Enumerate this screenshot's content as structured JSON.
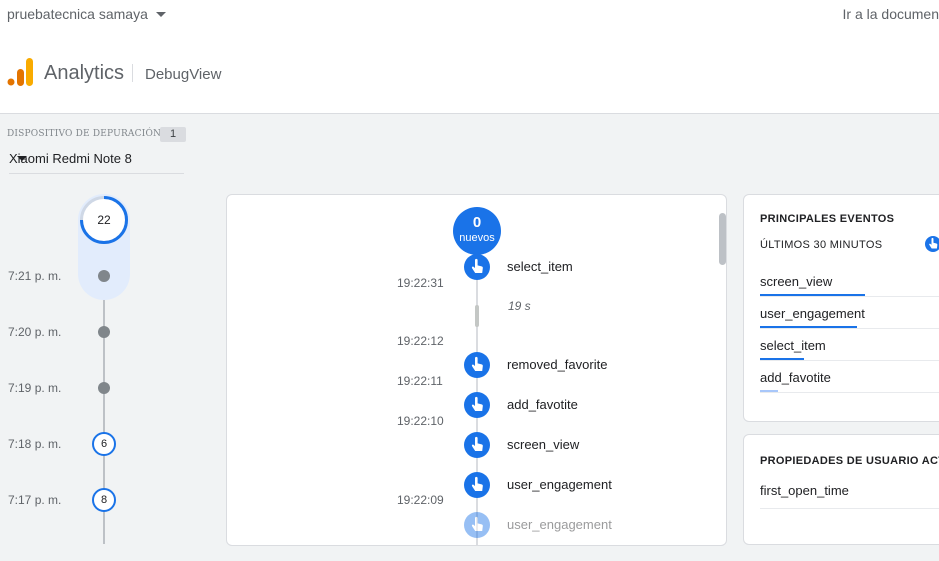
{
  "header": {
    "account": "pruebatecnica samaya",
    "doc_link": "Ir a la documen",
    "brand": "Analytics",
    "product": "DebugView"
  },
  "device": {
    "label": "DISPOSITIVO DE DEPURACIÓN",
    "count": "1",
    "selected": "Xiaomi Redmi Note 8"
  },
  "minutes": {
    "current_count": "22",
    "rows": [
      {
        "time": "7:21 p. m.",
        "count": ""
      },
      {
        "time": "7:20 p. m.",
        "count": ""
      },
      {
        "time": "7:19 p. m.",
        "count": ""
      },
      {
        "time": "7:18 p. m.",
        "count": "6"
      },
      {
        "time": "7:17 p. m.",
        "count": "8"
      }
    ]
  },
  "stream": {
    "new_count": "0",
    "new_label": "nuevos",
    "gap": "19 s",
    "timestamps": [
      "19:22:31",
      "19:22:12",
      "19:22:11",
      "19:22:10",
      "19:22:09"
    ],
    "events": [
      "select_item",
      "removed_favorite",
      "add_favotite",
      "screen_view",
      "user_engagement",
      "user_engagement"
    ]
  },
  "top_events": {
    "title": "PRINCIPALES EVENTOS",
    "subtitle": "ÚLTIMOS 30 MINUTOS",
    "items": [
      {
        "name": "screen_view",
        "share": 1.0
      },
      {
        "name": "user_engagement",
        "share": 0.92
      },
      {
        "name": "select_item",
        "share": 0.42
      },
      {
        "name": "add_favotite",
        "share": 0.17
      }
    ]
  },
  "user_props": {
    "title": "PROPIEDADES DE USUARIO ACTIVAS",
    "items": [
      "first_open_time"
    ]
  },
  "colors": {
    "accent": "#1a73e8",
    "dot": "#80868b"
  }
}
